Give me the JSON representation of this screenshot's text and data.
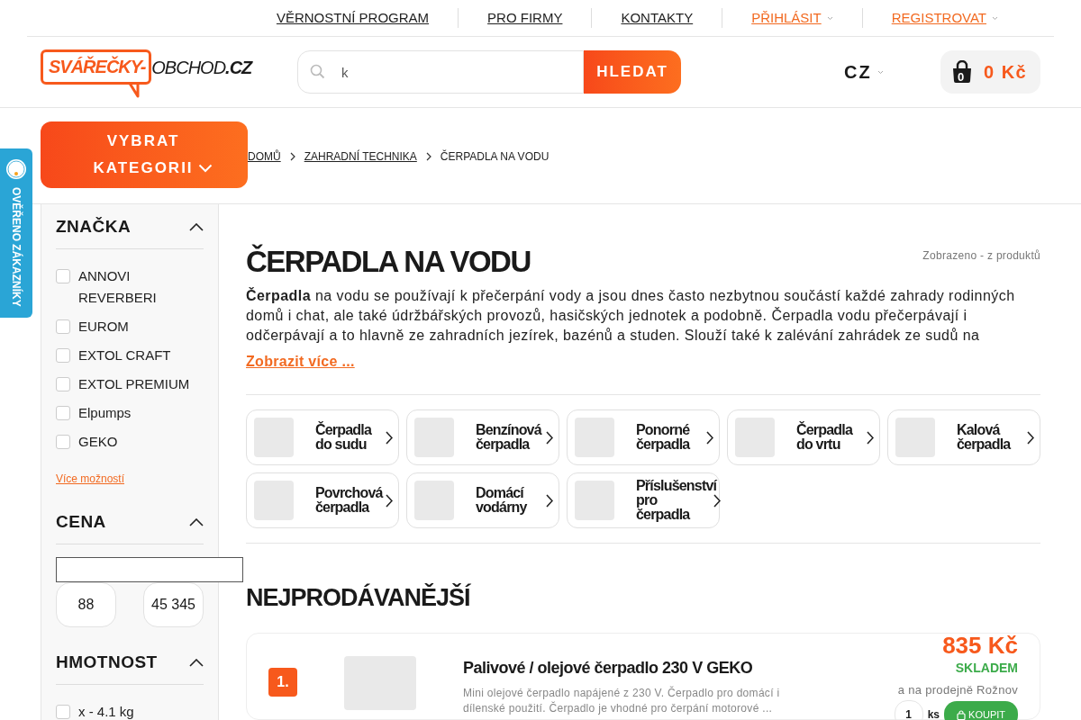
{
  "top_links": [
    {
      "label": "VĚRNOSTNÍ PROGRAM",
      "kind": "plain"
    },
    {
      "label": "PRO FIRMY",
      "kind": "plain"
    },
    {
      "label": "KONTAKTY",
      "kind": "plain"
    },
    {
      "label": "PŘIHLÁSIT",
      "kind": "account"
    },
    {
      "label": "REGISTROVAT",
      "kind": "account"
    }
  ],
  "header": {
    "logo": {
      "brand": "SVÁŘEČKY-",
      "middle": "OBCHOD",
      "suffix": ".CZ"
    },
    "search": {
      "value": "k",
      "button": "HLEDAT"
    },
    "language": "CZ",
    "cart": {
      "count": "0",
      "total": "0 Kč"
    }
  },
  "category_button": "VYBRAT KATEGORII",
  "breadcrumb": [
    {
      "label": "DOMŮ",
      "current": false
    },
    {
      "label": "ZAHRADNÍ TECHNIKA",
      "current": false
    },
    {
      "label": "ČERPADLA NA VODU",
      "current": true
    }
  ],
  "trust_badge": "OVĚŘENO ZÁKAZNÍKY",
  "filters": [
    {
      "title": "ZNAČKA",
      "kind": "checkbox",
      "expanded": true,
      "options": [
        {
          "label": "ANNOVI REVERBERI",
          "checked": false
        },
        {
          "label": "EUROM",
          "checked": false
        },
        {
          "label": "EXTOL CRAFT",
          "checked": false
        },
        {
          "label": "EXTOL PREMIUM",
          "checked": false
        },
        {
          "label": "Elpumps",
          "checked": false
        },
        {
          "label": "GEKO",
          "checked": false
        }
      ],
      "more_link": "Více možností"
    },
    {
      "title": "CENA",
      "kind": "range",
      "expanded": true,
      "min": "88",
      "max": "45 345"
    },
    {
      "title": "HMOTNOST",
      "kind": "checkbox",
      "expanded": true,
      "options": [
        {
          "label": "x - 4.1 kg",
          "checked": false
        }
      ]
    }
  ],
  "category": {
    "title": "ČERPADLA NA VODU",
    "shown_count": "Zobrazeno - z produktů",
    "description": "**Čerpadla** na vodu se používají k přečerpání vody a jsou dnes často nezbytnou součástí každé zahrady rodinných domů i chat, ale také údržbářských provozů, hasičských jednotek a podobně. Čerpadla vodu přečerpávají i odčerpávají a to hlavně ze zahradních jezírek, bazénů a studen. Slouží také k zalévání zahrádek ze sudů na",
    "more_link": "Zobrazit více ...",
    "subcategories": [
      {
        "label": "Čerpadla do sudu"
      },
      {
        "label": "Benzínová čerpadla"
      },
      {
        "label": "Ponorné čerpadla"
      },
      {
        "label": "Čerpadla do vrtu"
      },
      {
        "label": "Kalová čerpadla"
      },
      {
        "label": "Povrchová čerpadla"
      },
      {
        "label": "Domácí vodárny"
      },
      {
        "label": "Příslušenství pro čerpadla"
      }
    ]
  },
  "bestsellers": {
    "title": "NEJPRODÁVANĚJŠÍ",
    "products": [
      {
        "rank": "1.",
        "name": "Palivové / olejové čerpadlo 230 V GEKO",
        "description": "Mini olejové čerpadlo napájené z 230 V. Čerpadlo pro domácí i dílenské použití. Čerpadlo je vhodné pro čerpání motorové ...",
        "price": "835 Kč",
        "stock": "SKLADEM",
        "store_note": "a na prodejně Rožnov",
        "qty": "1",
        "unit": "ks",
        "buy": "KOUPIT"
      }
    ]
  }
}
